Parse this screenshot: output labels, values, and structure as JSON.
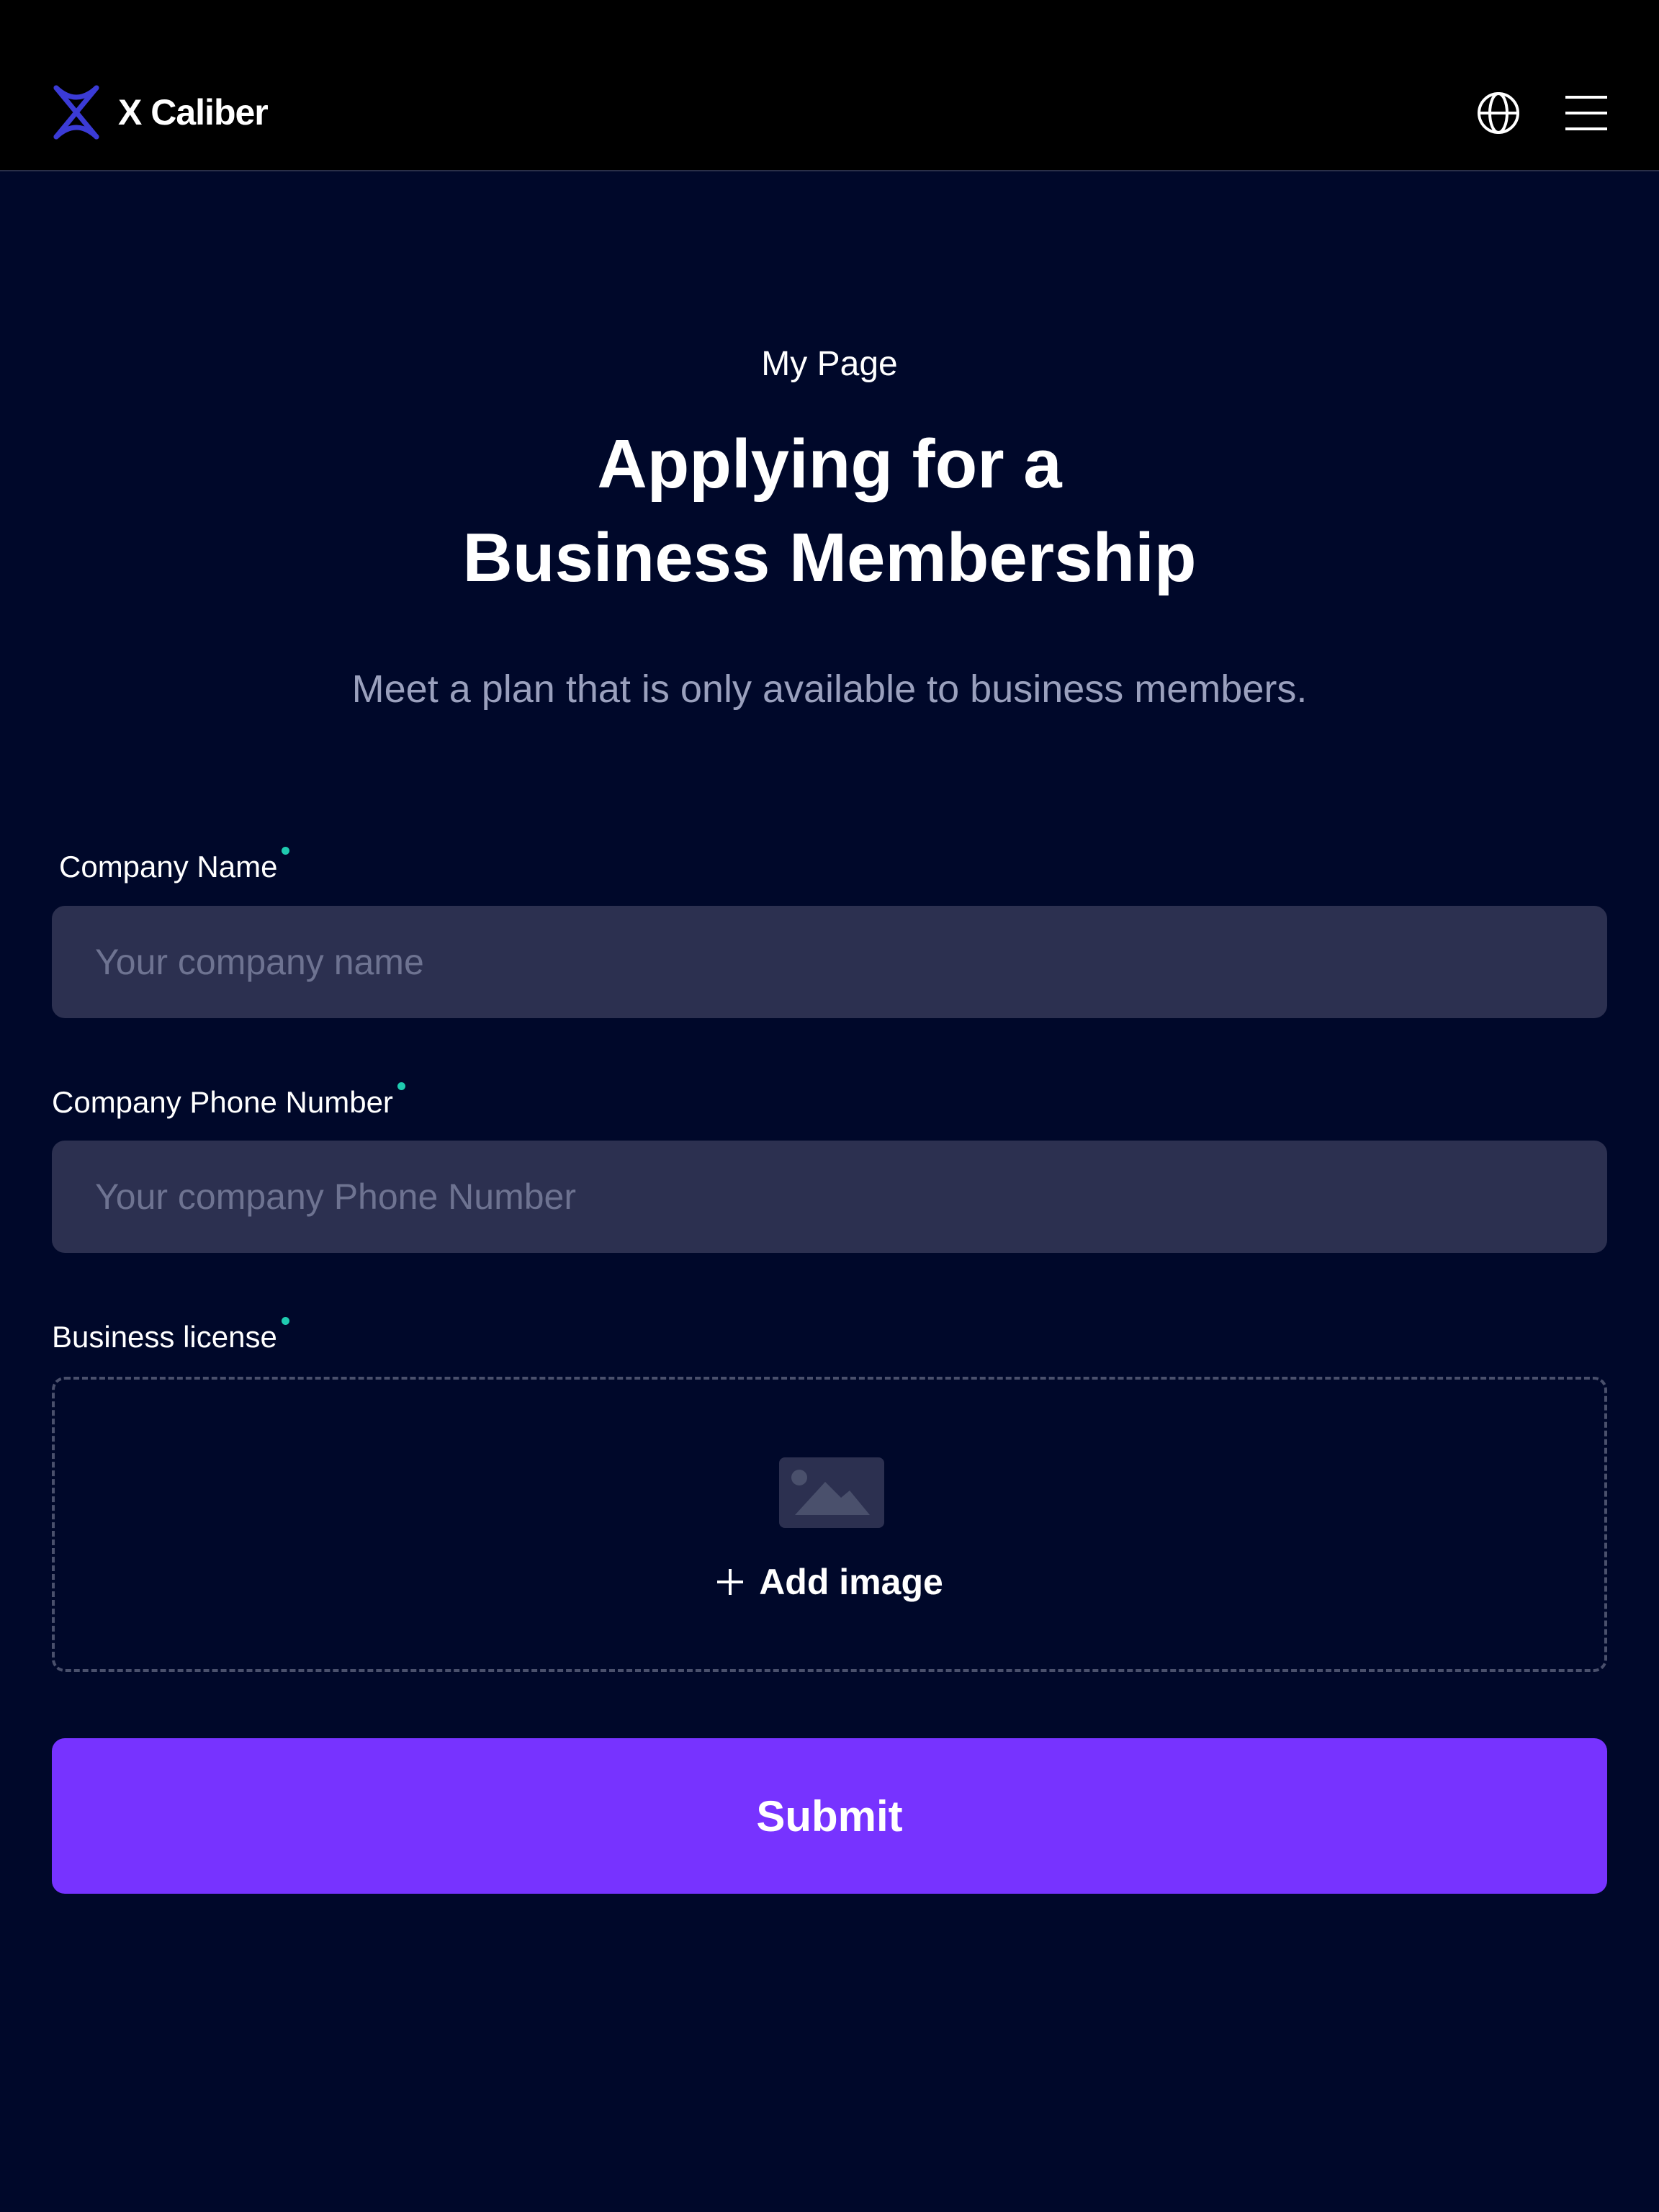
{
  "header": {
    "brand": "X Caliber",
    "brand_color": "#3b3bd6",
    "icons": [
      "globe-icon",
      "hamburger-menu-icon"
    ]
  },
  "page": {
    "breadcrumb": "My Page",
    "title_line1": "Applying for a",
    "title_line2": "Business Membership",
    "subtitle": "Meet a plan that is only available to business members."
  },
  "form": {
    "company_name": {
      "label": "Company Name",
      "placeholder": "Your company name",
      "value": ""
    },
    "company_phone": {
      "label": "Company Phone Number",
      "placeholder": "Your company Phone Number",
      "value": ""
    },
    "business_license": {
      "label": "Business license",
      "add_label": "Add image",
      "icon": "image-placeholder-icon"
    },
    "required_color": "#1fcbb0",
    "submit_label": "Submit",
    "submit_color": "#7733ff"
  }
}
